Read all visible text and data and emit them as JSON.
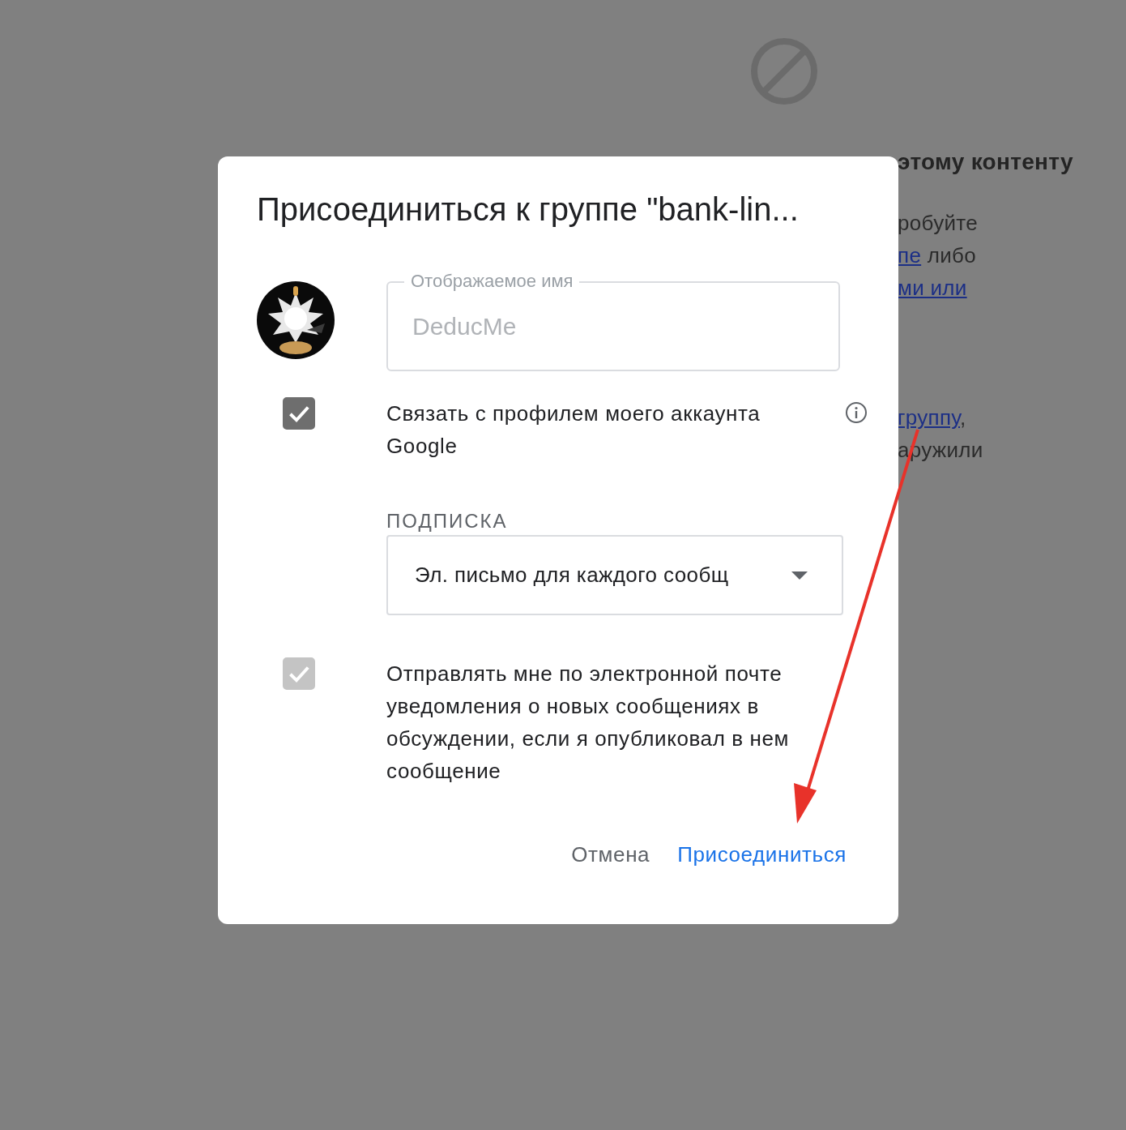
{
  "background": {
    "lines": [
      {
        "kind": "heading",
        "parts": [
          {
            "text": "этому контенту",
            "link": false
          }
        ]
      },
      {
        "kind": "text",
        "parts": [
          {
            "text": "робуйте",
            "link": false
          }
        ]
      },
      {
        "kind": "text",
        "parts": [
          {
            "text": "пе",
            "link": true
          },
          {
            "text": " либо",
            "link": false
          }
        ]
      },
      {
        "kind": "text",
        "parts": [
          {
            "text": "ми или",
            "link": true
          }
        ]
      },
      {
        "kind": "gap"
      },
      {
        "kind": "text",
        "parts": [
          {
            "text": "группу",
            "link": true
          },
          {
            "text": ",",
            "link": false
          }
        ]
      },
      {
        "kind": "text",
        "parts": [
          {
            "text": "аружили",
            "link": false
          }
        ]
      }
    ]
  },
  "dialog": {
    "title": "Присоединиться к группе \"bank-lin...",
    "display_name": {
      "label": "Отображаемое имя",
      "value": "DeducMe",
      "disabled": true
    },
    "options": [
      {
        "kind": "checkbox",
        "label": "Связать с профилем моего аккаунта Google",
        "checked": true,
        "disabled": false,
        "info": true
      },
      {
        "kind": "select",
        "label": "ПОДПИСКА",
        "value": "Эл. письмо для каждого сообщ"
      },
      {
        "kind": "checkbox",
        "label": "Отправлять мне по электронной почте уведомления о новых сообщениях в обсуждении, если я опубликовал в нем сообщение",
        "checked": true,
        "disabled": true,
        "info": false
      }
    ],
    "buttons": [
      {
        "label": "Отмена",
        "kind": "secondary"
      },
      {
        "label": "Присоединиться",
        "kind": "primary"
      }
    ]
  },
  "annotation": {
    "kind": "arrow"
  }
}
